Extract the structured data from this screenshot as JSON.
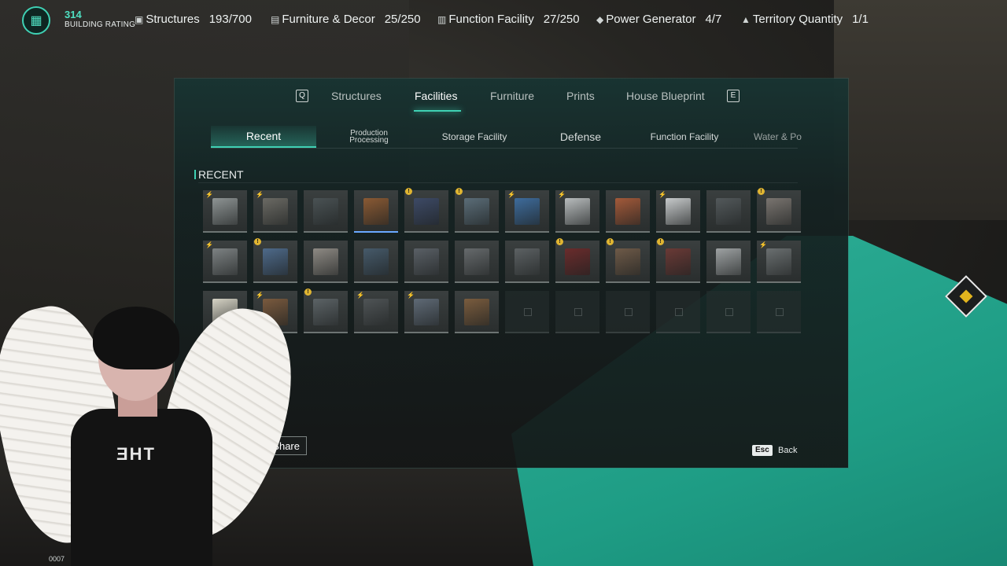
{
  "hud": {
    "rating_value": "314",
    "rating_label": "BUILDING RATING",
    "stats": [
      {
        "label": "Structures",
        "value": "193/700",
        "icon": "structures-icon"
      },
      {
        "label": "Furniture & Decor",
        "value": "25/250",
        "icon": "furniture-icon"
      },
      {
        "label": "Function Facility",
        "value": "27/250",
        "icon": "function-icon"
      },
      {
        "label": "Power Generator",
        "value": "4/7",
        "icon": "power-icon"
      },
      {
        "label": "Territory Quantity",
        "value": "1/1",
        "icon": "territory-icon"
      }
    ]
  },
  "panel": {
    "key_prev": "Q",
    "key_next": "E",
    "tabs": [
      "Structures",
      "Facilities",
      "Furniture",
      "Prints",
      "House Blueprint"
    ],
    "active_tab": "Facilities",
    "subtabs": [
      "Recent",
      "Production Processing",
      "Storage Facility",
      "Defense",
      "Function Facility",
      "Water & Po"
    ],
    "active_subtab": "Recent",
    "section_title": "RECENT",
    "share_label": "ge Share",
    "esc_key": "Esc",
    "back_label": "Back"
  },
  "slots": [
    {
      "mark": "bolt",
      "color": "#8e9494"
    },
    {
      "mark": "bolt",
      "color": "#6b6a64"
    },
    {
      "mark": "",
      "color": "#4a5254"
    },
    {
      "mark": "",
      "color": "#8a5a34",
      "selected": true
    },
    {
      "mark": "warn",
      "color": "#3d4a66"
    },
    {
      "mark": "warn",
      "color": "#5b6d78"
    },
    {
      "mark": "bolt",
      "color": "#3e6c9c"
    },
    {
      "mark": "bolt",
      "color": "#b8bcbd"
    },
    {
      "mark": "",
      "color": "#a35a3a"
    },
    {
      "mark": "bolt",
      "color": "#c7cacb"
    },
    {
      "mark": "",
      "color": "#53595b"
    },
    {
      "mark": "warn",
      "color": "#7a7570"
    },
    {
      "mark": "bolt",
      "color": "#7d8283"
    },
    {
      "mark": "warn",
      "color": "#4e6a8a"
    },
    {
      "mark": "",
      "color": "#8e8a84"
    },
    {
      "mark": "",
      "color": "#465a6a"
    },
    {
      "mark": "",
      "color": "#5a6066"
    },
    {
      "mark": "",
      "color": "#666a6c"
    },
    {
      "mark": "",
      "color": "#5c6163"
    },
    {
      "mark": "warn",
      "color": "#6a2c2c"
    },
    {
      "mark": "warn",
      "color": "#6e5a48"
    },
    {
      "mark": "warn",
      "color": "#6a3a36"
    },
    {
      "mark": "",
      "color": "#9ea2a3"
    },
    {
      "mark": "bolt",
      "color": "#6a6f70"
    },
    {
      "mark": "",
      "color": "#d6d3c5"
    },
    {
      "mark": "bolt",
      "color": "#7a5a3e"
    },
    {
      "mark": "warn",
      "color": "#5c6366"
    },
    {
      "mark": "bolt",
      "color": "#4f5456"
    },
    {
      "mark": "bolt",
      "color": "#5f6a76"
    },
    {
      "mark": "",
      "color": "#7a5c3e"
    },
    {
      "mark": "empty"
    },
    {
      "mark": "empty"
    },
    {
      "mark": "empty"
    },
    {
      "mark": "empty"
    },
    {
      "mark": "empty"
    },
    {
      "mark": "empty"
    }
  ],
  "overlay": {
    "shirt_text": "ƎHT",
    "counter": "0007"
  }
}
